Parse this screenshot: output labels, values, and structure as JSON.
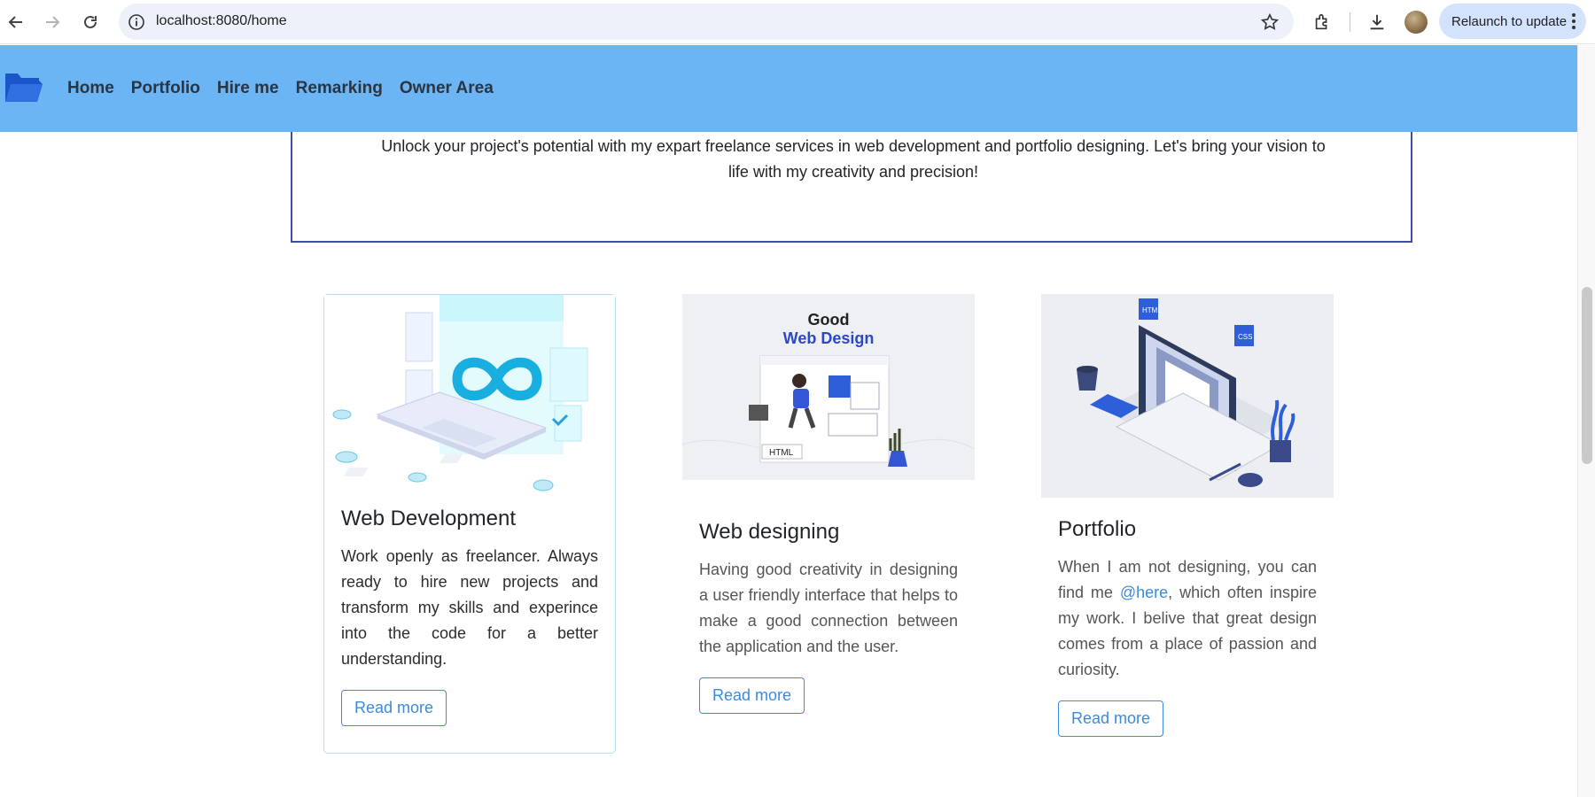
{
  "browser": {
    "url": "localhost:8080/home",
    "relaunch_label": "Relaunch to update"
  },
  "navbar": {
    "links": [
      "Home",
      "Portfolio",
      "Hire me",
      "Remarking",
      "Owner Area"
    ]
  },
  "hero": {
    "tagline": "Unlock your project's potential with my expart freelance services in web development and portfolio designing. Let's bring your vision to life with my creativity and precision!"
  },
  "cards": [
    {
      "title": "Web Development",
      "text": "Work openly as freelancer. Always ready to hire new projects and transform my skills and experince into the code for a better understanding.",
      "button": "Read more"
    },
    {
      "title": "Web designing",
      "image_heading_1": "Good",
      "image_heading_2": "Web Design",
      "image_tag": "HTML",
      "text": "Having good creativity in designing a user friendly interface that helps to make a good connection between the application and the user.",
      "button": "Read more"
    },
    {
      "title": "Portfolio",
      "image_tag_1": "HTML",
      "image_tag_2": "CSS",
      "text_before": "When I am not designing, you can find me ",
      "mention": "@here",
      "text_after": ", which often inspire my work. I belive that great design comes from a place of passion and curiosity.",
      "button": "Read more"
    }
  ],
  "colors": {
    "navbar": "#6bb5f5",
    "hero_border": "#3f4ea8",
    "accent": "#3a8ae0",
    "card_border": "#b9dcf6"
  }
}
